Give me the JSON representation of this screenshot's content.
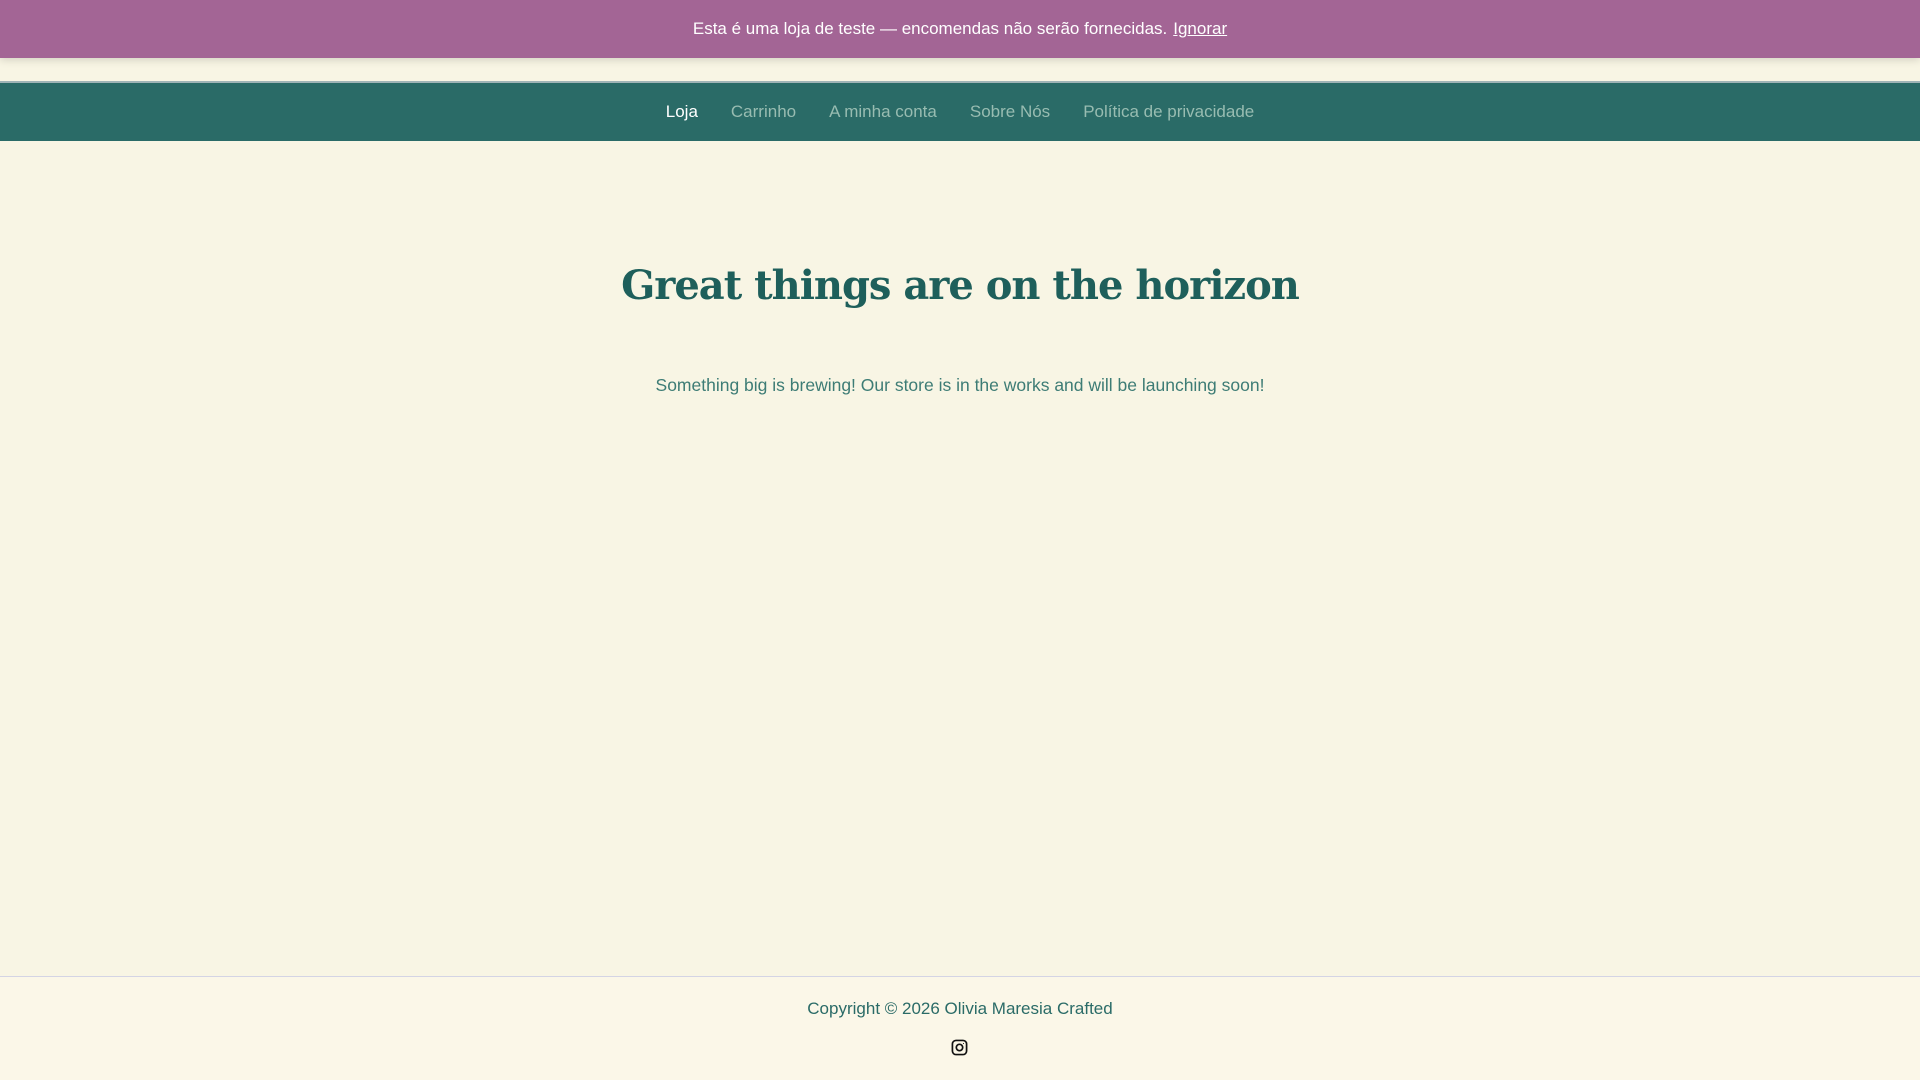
{
  "banner": {
    "text": "Esta é uma loja de teste — encomendas não serão fornecidas.",
    "dismiss": "Ignorar"
  },
  "nav": {
    "items": [
      {
        "label": "Loja"
      },
      {
        "label": "Carrinho"
      },
      {
        "label": "A minha conta"
      },
      {
        "label": "Sobre Nós"
      },
      {
        "label": "Política de privacidade"
      }
    ]
  },
  "main": {
    "title": "Great things are on the horizon",
    "subtitle": "Something big is brewing! Our store is in the works and will be launching soon!"
  },
  "footer": {
    "copyright": "Copyright © 2026 Olivia Maresia Crafted",
    "social_icon": "instagram-icon"
  }
}
